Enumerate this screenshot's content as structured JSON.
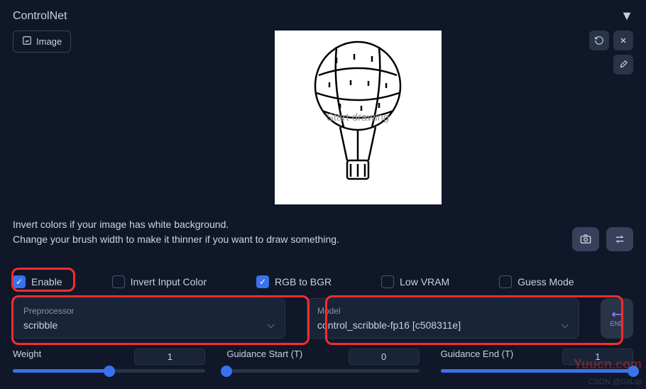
{
  "header": {
    "title": "ControlNet"
  },
  "image_button": {
    "label": "Image"
  },
  "canvas": {
    "placeholder": "Start drawing"
  },
  "hint": {
    "line1": "Invert colors if your image has white background.",
    "line2": "Change your brush width to make it thinner if you want to draw something."
  },
  "checkboxes": {
    "enable": {
      "label": "Enable",
      "checked": true
    },
    "invert": {
      "label": "Invert Input Color",
      "checked": false
    },
    "rgb2bgr": {
      "label": "RGB to BGR",
      "checked": true
    },
    "lowvram": {
      "label": "Low VRAM",
      "checked": false
    },
    "guess": {
      "label": "Guess Mode",
      "checked": false
    }
  },
  "dropdowns": {
    "preprocessor": {
      "label": "Preprocessor",
      "value": "scribble"
    },
    "model": {
      "label": "Model",
      "value": "control_scribble-fp16 [c508311e]"
    }
  },
  "sliders": {
    "weight": {
      "label": "Weight",
      "value": "1",
      "fill": 50
    },
    "gstart": {
      "label": "Guidance Start (T)",
      "value": "0",
      "fill": 0
    },
    "gend": {
      "label": "Guidance End (T)",
      "value": "1",
      "fill": 100
    }
  },
  "go_button": {
    "label": "END"
  },
  "watermark": "CSDN @GitLqr",
  "brand": "Yuucn.com"
}
